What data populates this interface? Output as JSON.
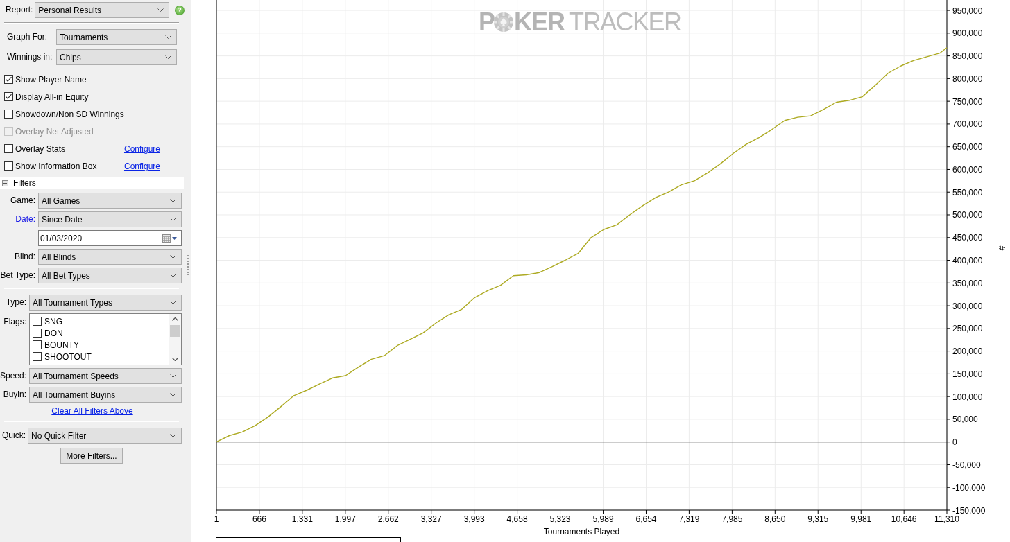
{
  "report": {
    "label": "Report:",
    "value": "Personal Results",
    "help": "?"
  },
  "graph_settings": [
    {
      "label": "Graph For:",
      "value": "Tournaments"
    },
    {
      "label": "Winnings in:",
      "value": "Chips"
    }
  ],
  "options": [
    {
      "label": "Show Player Name",
      "checked": true,
      "disabled": false
    },
    {
      "label": "Display All-in Equity",
      "checked": true,
      "disabled": false
    },
    {
      "label": "Showdown/Non SD Winnings",
      "checked": false,
      "disabled": false
    },
    {
      "label": "Overlay Net Adjusted",
      "checked": false,
      "disabled": true
    },
    {
      "label": "Overlay Stats",
      "checked": false,
      "disabled": false,
      "link": "Configure"
    },
    {
      "label": "Show Information Box",
      "checked": false,
      "disabled": false,
      "link": "Configure"
    }
  ],
  "filters": {
    "title": "Filters",
    "expanded": true,
    "general": [
      {
        "kind": "select",
        "label": "Game:",
        "value": "All Games",
        "active": false
      },
      {
        "kind": "select",
        "label": "Date:",
        "value": "Since Date",
        "active": true
      },
      {
        "kind": "date",
        "value": "01/03/2020"
      },
      {
        "kind": "select",
        "label": "Blind:",
        "value": "All Blinds",
        "active": false
      },
      {
        "kind": "select",
        "label": "Bet Type:",
        "value": "All Bet Types",
        "active": false
      }
    ],
    "tournament": [
      {
        "kind": "select",
        "label": "Type:",
        "value": "All Tournament Types",
        "active": false
      },
      {
        "kind": "list",
        "label": "Flags:",
        "active": false,
        "items": [
          {
            "label": "SNG",
            "checked": false
          },
          {
            "label": "DON",
            "checked": false
          },
          {
            "label": "BOUNTY",
            "checked": false
          },
          {
            "label": "SHOOTOUT",
            "checked": false
          }
        ]
      },
      {
        "kind": "select",
        "label": "Speed:",
        "value": "All Tournament Speeds",
        "active": false
      },
      {
        "kind": "select",
        "label": "Buyin:",
        "value": "All Tournament Buyins",
        "active": false
      }
    ],
    "clear_link": "Clear All Filters Above",
    "quick": {
      "label": "Quick:",
      "value": "No Quick Filter"
    },
    "more_button": "More Filters..."
  },
  "chart": {
    "logo": [
      "P",
      "KER",
      "TRACKER"
    ],
    "chart_data": {
      "type": "line",
      "xlabel": "Tournaments Played",
      "ylabel": "#",
      "grid": true,
      "x": [
        1,
        200,
        400,
        600,
        800,
        1000,
        1200,
        1400,
        1600,
        1800,
        2000,
        2200,
        2400,
        2600,
        2800,
        3000,
        3200,
        3400,
        3600,
        3800,
        4000,
        4200,
        4400,
        4600,
        4800,
        5000,
        5200,
        5400,
        5600,
        5800,
        6000,
        6200,
        6400,
        6600,
        6800,
        7000,
        7200,
        7400,
        7600,
        7800,
        8000,
        8200,
        8400,
        8600,
        8800,
        9000,
        9200,
        9400,
        9600,
        9800,
        10000,
        10200,
        10400,
        10600,
        10800,
        11000,
        11200,
        11310
      ],
      "series": [
        {
          "color": "#adaa22",
          "values": [
            0,
            14000,
            22000,
            36000,
            55000,
            78000,
            102000,
            114000,
            128000,
            141000,
            146000,
            165000,
            182000,
            190000,
            212000,
            226000,
            240000,
            262000,
            280000,
            292000,
            318000,
            333000,
            345000,
            366000,
            368000,
            373000,
            386000,
            400000,
            415000,
            450000,
            468000,
            478000,
            500000,
            520000,
            538000,
            550000,
            566000,
            575000,
            592000,
            612000,
            635000,
            655000,
            670000,
            688000,
            708000,
            715000,
            718000,
            732000,
            748000,
            752000,
            760000,
            785000,
            812000,
            828000,
            840000,
            848000,
            856000,
            868000
          ]
        }
      ],
      "xlim": [
        1,
        11310
      ],
      "ylim": [
        -150000,
        973000
      ],
      "xticks": [
        1,
        {
          "value": 666,
          "label": "666"
        },
        {
          "value": 1331,
          "label": "1,331"
        },
        {
          "value": 1997,
          "label": "1,997"
        },
        {
          "value": 2662,
          "label": "2,662"
        },
        {
          "value": 3327,
          "label": "3,327"
        },
        {
          "value": 3993,
          "label": "3,993"
        },
        {
          "value": 4658,
          "label": "4,658"
        },
        {
          "value": 5323,
          "label": "5,323"
        },
        {
          "value": 5989,
          "label": "5,989"
        },
        {
          "value": 6654,
          "label": "6,654"
        },
        {
          "value": 7319,
          "label": "7,319"
        },
        {
          "value": 7985,
          "label": "7,985"
        },
        {
          "value": 8650,
          "label": "8,650"
        },
        {
          "value": 9315,
          "label": "9,315"
        },
        {
          "value": 9981,
          "label": "9,981"
        },
        {
          "value": 10646,
          "label": "10,646"
        },
        {
          "value": 11310,
          "label": "11,310"
        }
      ],
      "yticks": [
        {
          "value": -150000,
          "label": "-150,000"
        },
        {
          "value": -100000,
          "label": "-100,000"
        },
        {
          "value": -50000,
          "label": "-50,000"
        },
        0,
        {
          "value": 50000,
          "label": "50,000"
        },
        {
          "value": 100000,
          "label": "100,000"
        },
        {
          "value": 150000,
          "label": "150,000"
        },
        {
          "value": 200000,
          "label": "200,000"
        },
        {
          "value": 250000,
          "label": "250,000"
        },
        {
          "value": 300000,
          "label": "300,000"
        },
        {
          "value": 350000,
          "label": "350,000"
        },
        {
          "value": 400000,
          "label": "400,000"
        },
        {
          "value": 450000,
          "label": "450,000"
        },
        {
          "value": 500000,
          "label": "500,000"
        },
        {
          "value": 550000,
          "label": "550,000"
        },
        {
          "value": 600000,
          "label": "600,000"
        },
        {
          "value": 650000,
          "label": "650,000"
        },
        {
          "value": 700000,
          "label": "700,000"
        },
        {
          "value": 750000,
          "label": "750,000"
        },
        {
          "value": 800000,
          "label": "800,000"
        },
        {
          "value": 850000,
          "label": "850,000"
        },
        {
          "value": 900000,
          "label": "900,000"
        },
        {
          "value": 950000,
          "label": "950,000"
        }
      ]
    }
  }
}
